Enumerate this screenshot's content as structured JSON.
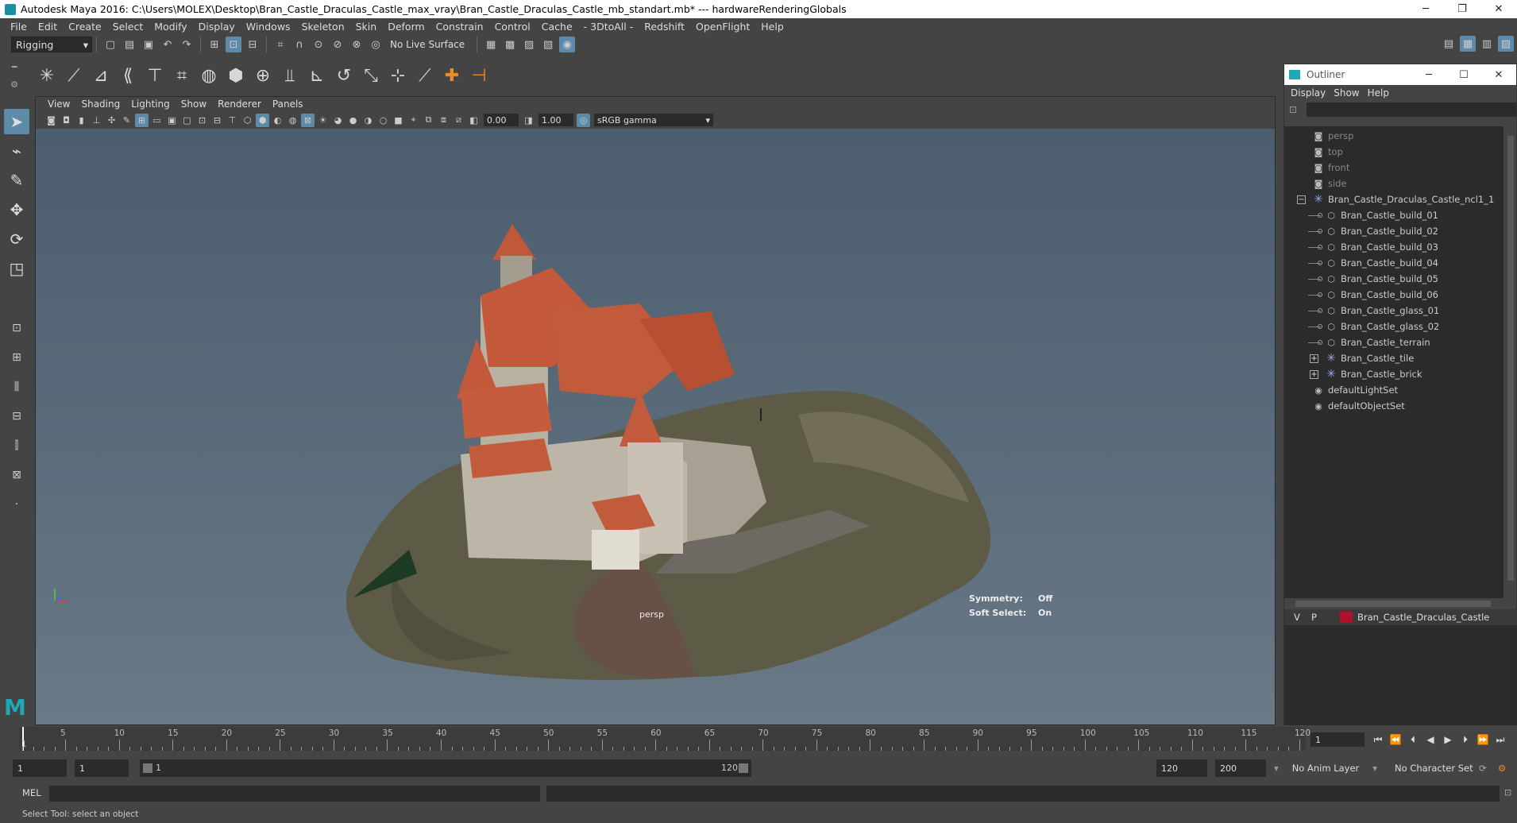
{
  "window": {
    "title": "Autodesk Maya 2016: C:\\Users\\MOLEX\\Desktop\\Bran_Castle_Draculas_Castle_max_vray\\Bran_Castle_Draculas_Castle_mb_standart.mb*   ---   hardwareRenderingGlobals",
    "minimize": "─",
    "restore": "❐",
    "close": "✕"
  },
  "menubar": [
    "File",
    "Edit",
    "Create",
    "Select",
    "Modify",
    "Display",
    "Windows",
    "Skeleton",
    "Skin",
    "Deform",
    "Constrain",
    "Control",
    "Cache",
    "- 3DtoAll -",
    "Redshift",
    "OpenFlight",
    "Help"
  ],
  "statusline": {
    "mode": "Rigging",
    "live_surface": "No Live Surface"
  },
  "viewport": {
    "menus": [
      "View",
      "Shading",
      "Lighting",
      "Show",
      "Renderer",
      "Panels"
    ],
    "exposure": "0.00",
    "gamma": "1.00",
    "color_space": "sRGB gamma",
    "camera_label": "persp",
    "symmetry_label": "Symmetry:",
    "symmetry_value": "Off",
    "soft_select_label": "Soft Select:",
    "soft_select_value": "On"
  },
  "outliner": {
    "title": "Outliner",
    "menus": [
      "Display",
      "Show",
      "Help"
    ],
    "items": [
      {
        "label": "persp",
        "indent": 0,
        "kind": "camera",
        "dim": true
      },
      {
        "label": "top",
        "indent": 0,
        "kind": "camera",
        "dim": true
      },
      {
        "label": "front",
        "indent": 0,
        "kind": "camera",
        "dim": true
      },
      {
        "label": "side",
        "indent": 0,
        "kind": "camera",
        "dim": true
      },
      {
        "label": "Bran_Castle_Draculas_Castle_ncl1_1",
        "indent": 0,
        "kind": "group",
        "expander": "−"
      },
      {
        "label": "Bran_Castle_build_01",
        "indent": 1,
        "kind": "mesh"
      },
      {
        "label": "Bran_Castle_build_02",
        "indent": 1,
        "kind": "mesh"
      },
      {
        "label": "Bran_Castle_build_03",
        "indent": 1,
        "kind": "mesh"
      },
      {
        "label": "Bran_Castle_build_04",
        "indent": 1,
        "kind": "mesh"
      },
      {
        "label": "Bran_Castle_build_05",
        "indent": 1,
        "kind": "mesh"
      },
      {
        "label": "Bran_Castle_build_06",
        "indent": 1,
        "kind": "mesh"
      },
      {
        "label": "Bran_Castle_glass_01",
        "indent": 1,
        "kind": "mesh"
      },
      {
        "label": "Bran_Castle_glass_02",
        "indent": 1,
        "kind": "mesh"
      },
      {
        "label": "Bran_Castle_terrain",
        "indent": 1,
        "kind": "mesh"
      },
      {
        "label": "Bran_Castle_tile",
        "indent": 1,
        "kind": "group",
        "expander": "+"
      },
      {
        "label": "Bran_Castle_brick",
        "indent": 1,
        "kind": "group",
        "expander": "+"
      },
      {
        "label": "defaultLightSet",
        "indent": 0,
        "kind": "set"
      },
      {
        "label": "defaultObjectSet",
        "indent": 0,
        "kind": "set"
      }
    ],
    "layer": {
      "v": "V",
      "p": "P",
      "name": "Bran_Castle_Draculas_Castle",
      "color": "#b0102a"
    }
  },
  "timeline": {
    "ticks": [
      "5",
      "10",
      "15",
      "20",
      "25",
      "30",
      "35",
      "40",
      "45",
      "50",
      "55",
      "60",
      "65",
      "70",
      "75",
      "80",
      "85",
      "90",
      "95",
      "100",
      "105",
      "110",
      "115",
      "120"
    ],
    "start_label": "1",
    "current_frame": "1"
  },
  "range": {
    "start": "1",
    "playback_start": "1",
    "slider_start": "1",
    "slider_end": "120",
    "playback_end": "120",
    "end": "200",
    "anim_layer": "No Anim Layer",
    "character_set": "No Character Set"
  },
  "command": {
    "language": "MEL",
    "help": "Select Tool: select an object"
  }
}
